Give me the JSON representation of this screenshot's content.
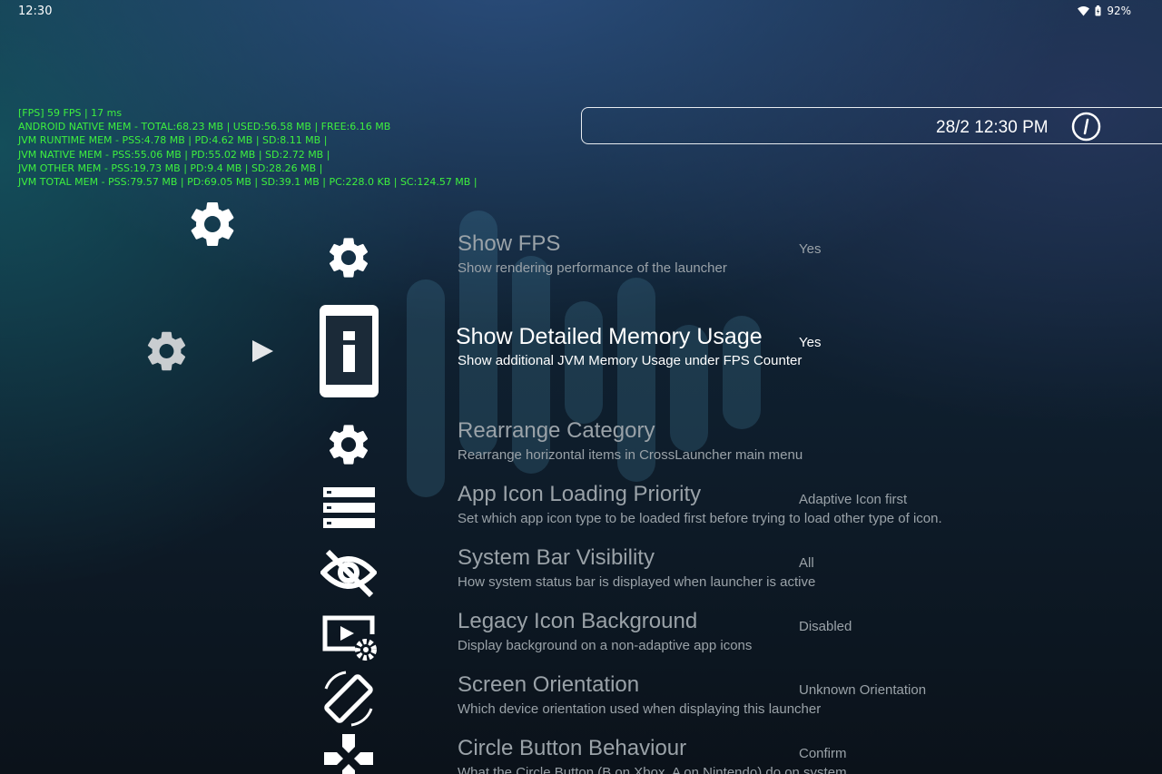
{
  "status_bar": {
    "time": "12:30",
    "battery": "92%",
    "icons": [
      "wifi-icon",
      "battery-icon"
    ]
  },
  "debug_overlay": [
    "[FPS] 59 FPS | 17 ms",
    "ANDROID NATIVE MEM - TOTAL:68.23 MB | USED:56.58 MB | FREE:6.16 MB",
    "JVM RUNTIME MEM - PSS:4.78 MB | PD:4.62 MB | SD:8.11 MB |",
    "JVM NATIVE MEM - PSS:55.06 MB | PD:55.02 MB | SD:2.72 MB |",
    "JVM OTHER MEM - PSS:19.73 MB | PD:9.4 MB | SD:28.26 MB |",
    "JVM TOTAL MEM - PSS:79.57 MB | PD:69.05 MB | SD:39.1 MB | PC:228.0 KB | SC:124.57 MB |"
  ],
  "clock": {
    "text": "28/2 12:30 PM",
    "icon": "power-icon"
  },
  "categories": [
    {
      "icon": "settings-gear-icon",
      "selected": false
    },
    {
      "icon": "settings-gear-icon",
      "selected": true
    }
  ],
  "settings": [
    {
      "title": "Show FPS",
      "description": "Show rendering performance of the launcher",
      "value": "Yes",
      "icon": "gear-icon",
      "active": false
    },
    {
      "title": "Show Detailed Memory Usage",
      "description": "Show additional JVM Memory Usage under FPS Counter",
      "value": "Yes",
      "icon": "info-icon",
      "active": true
    },
    {
      "title": "Rearrange Category",
      "description": "Rearrange horizontal items in CrossLauncher main menu",
      "value": "",
      "icon": "gear-icon",
      "active": false
    },
    {
      "title": "App Icon Loading Priority",
      "description": "Set which app icon type to be loaded first before trying to load other type of icon.",
      "value": "Adaptive Icon first",
      "icon": "list-icon",
      "active": false
    },
    {
      "title": "System Bar Visibility",
      "description": "How system status bar is displayed when launcher is active",
      "value": "All",
      "icon": "visibility-off-icon",
      "active": false
    },
    {
      "title": "Legacy Icon Background",
      "description": "Display background on a non-adaptive app icons",
      "value": "Disabled",
      "icon": "video-settings-icon",
      "active": false
    },
    {
      "title": "Screen Orientation",
      "description": "Which device orientation used when displaying this launcher",
      "value": "Unknown Orientation",
      "icon": "screen-rotation-icon",
      "active": false
    },
    {
      "title": "Circle Button Behaviour",
      "description": "What the Circle Button (B on Xbox, A on Nintendo) do on system",
      "value": "Confirm",
      "icon": "gamepad-icon",
      "active": false
    }
  ]
}
